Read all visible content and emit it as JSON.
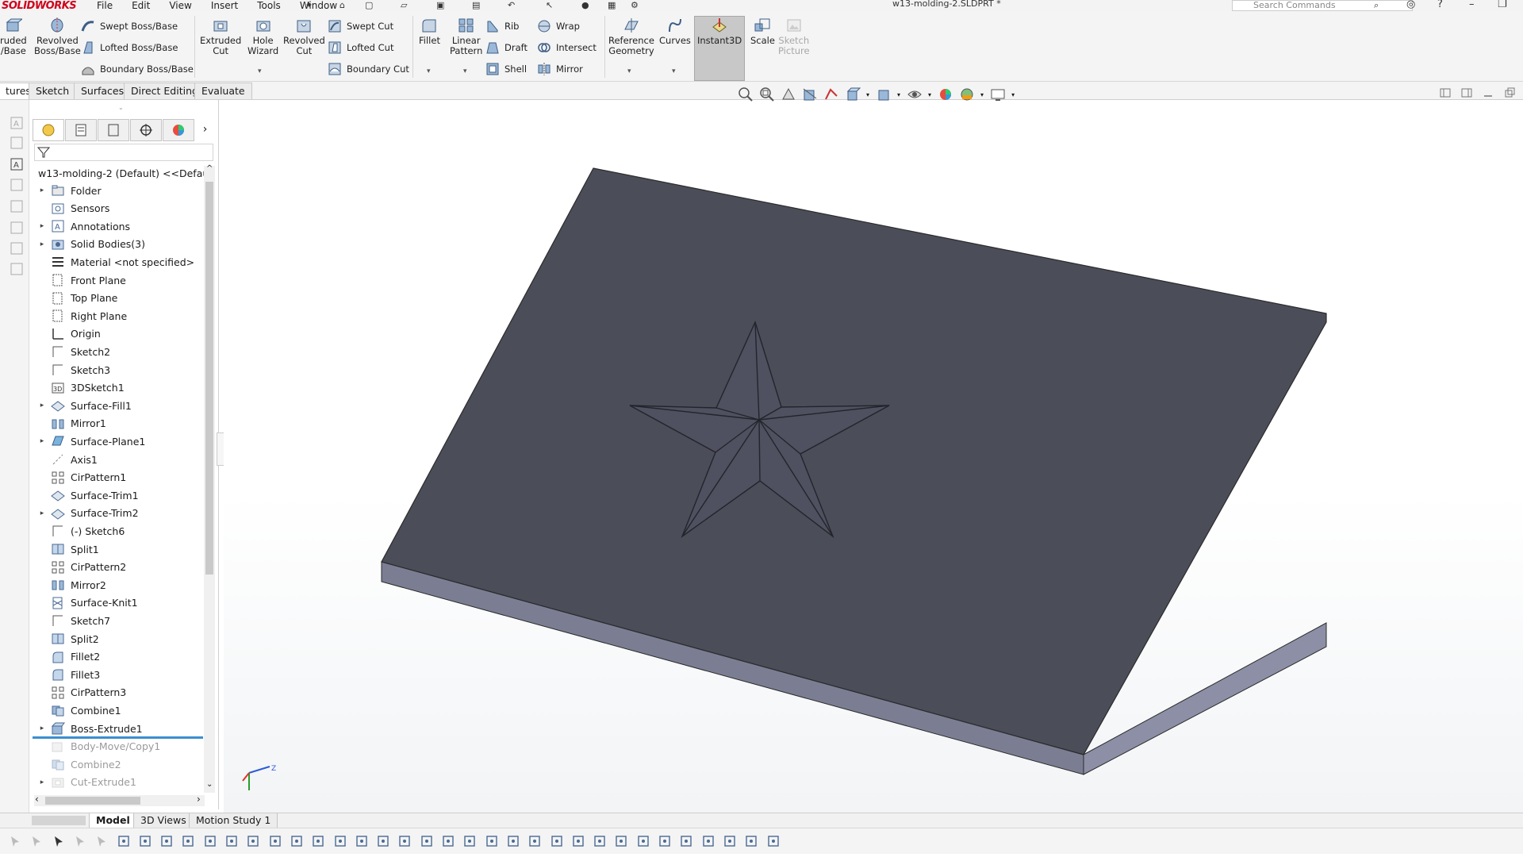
{
  "app": {
    "logo": "SOLIDWORKS",
    "document_title": "w13-molding-2.SLDPRT *",
    "search_placeholder": "Search Commands"
  },
  "menus": [
    "File",
    "Edit",
    "View",
    "Insert",
    "Tools",
    "Window"
  ],
  "ribbon": {
    "extruded_boss": "ruded\n/Base",
    "revolved_boss": "Revolved\nBoss/Base",
    "swept_boss": "Swept Boss/Base",
    "lofted_boss": "Lofted Boss/Base",
    "boundary_boss": "Boundary Boss/Base",
    "extruded_cut": "Extruded\nCut",
    "hole_wizard": "Hole\nWizard",
    "revolved_cut": "Revolved\nCut",
    "swept_cut": "Swept Cut",
    "lofted_cut": "Lofted Cut",
    "boundary_cut": "Boundary Cut",
    "fillet": "Fillet",
    "linear_pattern": "Linear\nPattern",
    "rib": "Rib",
    "draft": "Draft",
    "shell": "Shell",
    "wrap": "Wrap",
    "intersect": "Intersect",
    "mirror": "Mirror",
    "reference_geometry": "Reference\nGeometry",
    "curves": "Curves",
    "instant3d": "Instant3D",
    "scale": "Scale",
    "sketch_picture": "Sketch\nPicture"
  },
  "command_tabs": [
    "tures",
    "Sketch",
    "Surfaces",
    "Direct Editing",
    "Evaluate"
  ],
  "feature_tree": {
    "root": "w13-molding-2 (Default) <<Defaul",
    "items": [
      {
        "label": "Folder",
        "expandable": true,
        "icon": "folder-icon"
      },
      {
        "label": "Sensors",
        "expandable": false,
        "icon": "sensor-icon"
      },
      {
        "label": "Annotations",
        "expandable": true,
        "icon": "annotation-icon"
      },
      {
        "label": "Solid Bodies(3)",
        "expandable": true,
        "icon": "solid-bodies-icon"
      },
      {
        "label": "Material <not specified>",
        "expandable": false,
        "icon": "material-icon"
      },
      {
        "label": "Front Plane",
        "expandable": false,
        "icon": "plane-icon"
      },
      {
        "label": "Top Plane",
        "expandable": false,
        "icon": "plane-icon"
      },
      {
        "label": "Right Plane",
        "expandable": false,
        "icon": "plane-icon"
      },
      {
        "label": "Origin",
        "expandable": false,
        "icon": "origin-icon"
      },
      {
        "label": "Sketch2",
        "expandable": false,
        "icon": "sketch-icon"
      },
      {
        "label": "Sketch3",
        "expandable": false,
        "icon": "sketch-icon"
      },
      {
        "label": "3DSketch1",
        "expandable": false,
        "icon": "3dsketch-icon"
      },
      {
        "label": "Surface-Fill1",
        "expandable": true,
        "icon": "surface-icon"
      },
      {
        "label": "Mirror1",
        "expandable": false,
        "icon": "mirror-icon"
      },
      {
        "label": "Surface-Plane1",
        "expandable": true,
        "icon": "surface-plane-icon"
      },
      {
        "label": "Axis1",
        "expandable": false,
        "icon": "axis-icon"
      },
      {
        "label": "CirPattern1",
        "expandable": false,
        "icon": "circular-pattern-icon"
      },
      {
        "label": "Surface-Trim1",
        "expandable": false,
        "icon": "surface-icon"
      },
      {
        "label": "Surface-Trim2",
        "expandable": true,
        "icon": "surface-icon"
      },
      {
        "label": "(-) Sketch6",
        "expandable": false,
        "icon": "sketch-icon"
      },
      {
        "label": "Split1",
        "expandable": false,
        "icon": "split-icon"
      },
      {
        "label": "CirPattern2",
        "expandable": false,
        "icon": "circular-pattern-icon"
      },
      {
        "label": "Mirror2",
        "expandable": false,
        "icon": "mirror-icon"
      },
      {
        "label": "Surface-Knit1",
        "expandable": false,
        "icon": "knit-icon"
      },
      {
        "label": "Sketch7",
        "expandable": false,
        "icon": "sketch-icon"
      },
      {
        "label": "Split2",
        "expandable": false,
        "icon": "split-icon"
      },
      {
        "label": "Fillet2",
        "expandable": false,
        "icon": "fillet-icon"
      },
      {
        "label": "Fillet3",
        "expandable": false,
        "icon": "fillet-icon"
      },
      {
        "label": "CirPattern3",
        "expandable": false,
        "icon": "circular-pattern-icon"
      },
      {
        "label": "Combine1",
        "expandable": false,
        "icon": "combine-icon"
      },
      {
        "label": "Boss-Extrude1",
        "expandable": true,
        "icon": "extrude-icon"
      },
      {
        "label": "Body-Move/Copy1",
        "expandable": false,
        "icon": "move-copy-icon",
        "suppressed": true
      },
      {
        "label": "Combine2",
        "expandable": false,
        "icon": "combine-icon",
        "suppressed": true
      },
      {
        "label": "Cut-Extrude1",
        "expandable": true,
        "icon": "cut-extrude-icon",
        "suppressed": true
      }
    ]
  },
  "bottom_tabs": [
    "Model",
    "3D Views",
    "Motion Study 1"
  ],
  "colors": {
    "part_top": "#4b4d59",
    "part_side": "#8d8fa6",
    "part_front": "#7b7e93",
    "rollback": "#3c8fd0",
    "logo": "#d0021b"
  }
}
